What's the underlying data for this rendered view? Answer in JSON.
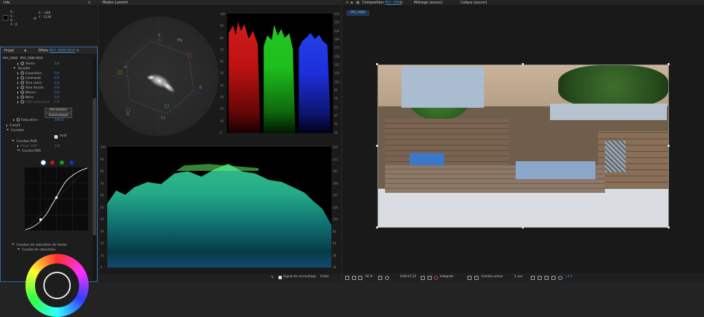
{
  "info": {
    "title": "Info",
    "r_label": "R :",
    "g_label": "V :",
    "b_label": "B :",
    "a_label": "A : 0",
    "x_label": "X : -208",
    "y_label": "Y : 1138"
  },
  "effects": {
    "tab_project": "Projet",
    "tab_effects": "Effets",
    "tab_effects_target": "MVI_0886.MOV",
    "path": "MVI_0886 · MVI_0886.MOV",
    "rows": [
      {
        "label": "Teinte",
        "value": "0,0"
      },
      {
        "label": "Tonalité",
        "value": ""
      },
      {
        "label": "Exposition",
        "value": "0,0"
      },
      {
        "label": "Contraste",
        "value": "0,0"
      },
      {
        "label": "Tons clairs",
        "value": "0,0"
      },
      {
        "label": "Tons foncés",
        "value": "0,0"
      },
      {
        "label": "Blancs",
        "value": "0,0"
      },
      {
        "label": "Noirs",
        "value": "0,0"
      },
      {
        "label": "HDR spéculaire",
        "value": "0,0"
      }
    ],
    "reset_button": "Réinitialiser",
    "auto_button": "Automatique",
    "saturation_label": "Saturation",
    "saturation_value": "100,0",
    "creative": "Créatif",
    "curves": "Courbes",
    "active_label": "Actif",
    "rgb_curves": "Courbes RVB",
    "hdr_range_label": "Plage HDR",
    "hdr_range_value": "100",
    "rgb_curves_sub": "Courbe RVB",
    "hue_sat_curves": "Courbes de saturation de teinte",
    "sat_curve": "Courbe de saturation"
  },
  "lumetri": {
    "title": "Modes Lumetri",
    "vectorscope_labels": [
      "R",
      "Mg",
      "B",
      "Cy",
      "G",
      "Yl"
    ],
    "parade_ticks_left": [
      "100",
      "90",
      "80",
      "70",
      "60",
      "50",
      "40",
      "30",
      "20",
      "10",
      "0"
    ],
    "parade_ticks_right": [
      "235",
      "220",
      "204",
      "189",
      "173",
      "158",
      "142",
      "126",
      "110",
      "95",
      "79",
      "63",
      "47",
      "32",
      "16"
    ],
    "waveform_ticks_left": [
      "100",
      "90",
      "80",
      "70",
      "60",
      "50",
      "40",
      "30",
      "20",
      "10",
      "0"
    ],
    "waveform_ticks_right": [
      "235",
      "213",
      "191",
      "169",
      "147",
      "126",
      "104",
      "82",
      "60",
      "38",
      "16"
    ],
    "bottom_label": "Signal de verrouillage",
    "bottom_value": "8 bits"
  },
  "composition": {
    "tab": "Composition",
    "tab_target": "MVI_0886",
    "footage_tab": "Métrage",
    "footage_value": "(aucun)",
    "layer_tab": "Calque",
    "layer_value": "(aucun)",
    "subtab": "MVI_0886"
  },
  "toolbar": {
    "zoom": "50 %",
    "timecode": "0:00:47:22",
    "resolution": "Intégrale",
    "camera": "Caméra active",
    "views": "1 vue",
    "exposure": "+0,0"
  },
  "colors": {
    "accent": "#3b8fd9",
    "panel_bg": "#1d1d1d",
    "red": "#e02020",
    "green": "#22c230",
    "blue": "#2040f0"
  }
}
